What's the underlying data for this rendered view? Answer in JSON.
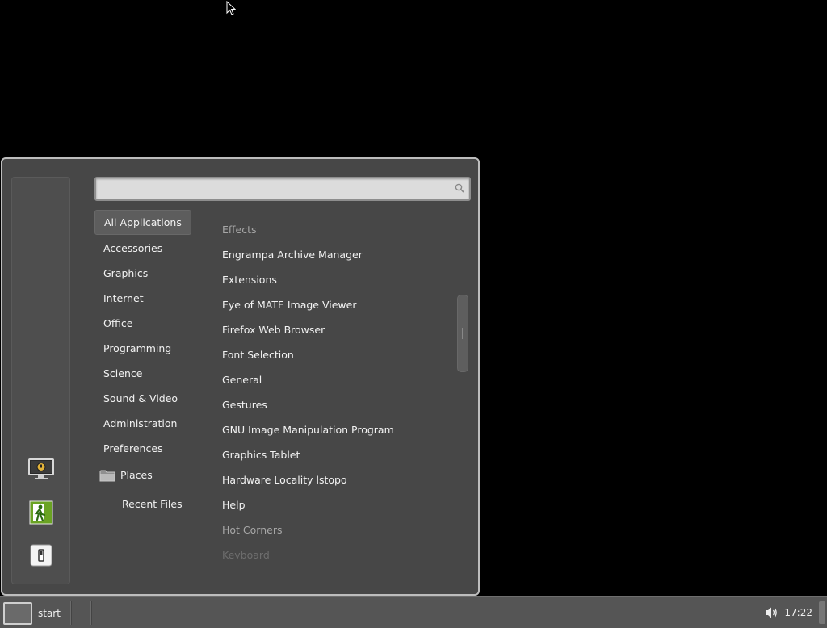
{
  "search": {
    "value": "",
    "placeholder": ""
  },
  "categories": [
    "All Applications",
    "Accessories",
    "Graphics",
    "Internet",
    "Office",
    "Programming",
    "Science",
    "Sound & Video",
    "Administration",
    "Preferences"
  ],
  "places": {
    "label": "Places",
    "recent": "Recent Files"
  },
  "apps": [
    "Effects",
    "Engrampa Archive Manager",
    "Extensions",
    "Eye of MATE Image Viewer",
    "Firefox Web Browser",
    "Font Selection",
    "General",
    "Gestures",
    "GNU Image Manipulation Program",
    "Graphics Tablet",
    "Hardware Locality lstopo",
    "Help",
    "Hot Corners",
    "Keyboard"
  ],
  "favorites": [
    "lock-screen-icon",
    "logout-icon",
    "power-icon"
  ],
  "taskbar": {
    "start_label": "start",
    "clock": "17:22"
  },
  "colors": {
    "menu_bg": "#474747",
    "taskbar_bg": "#555555",
    "accent_green": "#6aa323"
  }
}
